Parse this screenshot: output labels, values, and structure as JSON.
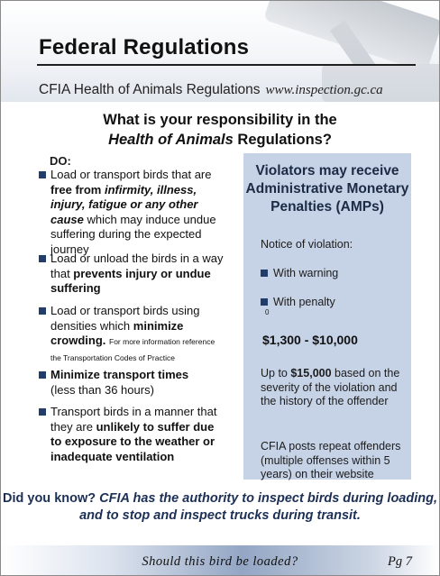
{
  "header": {
    "title": "Federal Regulations",
    "subtitle": "CFIA Health of Animals Regulations",
    "url": "www.inspection.gc.ca"
  },
  "question": {
    "line1": "What is your responsibility in the",
    "line2_italic": "Health of Animals",
    "line2_rest": " Regulations?"
  },
  "do_list": {
    "label": "DO:",
    "items": [
      {
        "a": "Load or transport birds that are ",
        "b": "free from ",
        "c": "infirmity, illness, injury, fatigue or any other cause",
        "d": " which may induce undue suffering during the expected journey"
      },
      {
        "a": "Load or unload the birds in a way that ",
        "b": "prevents injury or undue suffering"
      },
      {
        "a": "Load or transport birds using densities which ",
        "b": "minimize crowding.",
        "c": "For more information reference the Transportation Codes of Practice"
      },
      {
        "a": "Minimize transport times",
        "b": "(less than 36 hours)"
      },
      {
        "a": "Transport birds in a manner that they are ",
        "b": "unlikely to suffer due to exposure to the weather or inadequate ventilation"
      }
    ]
  },
  "penalty_box": {
    "title": "Violators may receive Administrative Monetary Penalties (AMPs)",
    "notice": "Notice of violation:",
    "option1": "With warning",
    "option2": "With penalty",
    "marker": "0",
    "amount": "$1,300 - $10,000",
    "upto_prefix": "Up to ",
    "upto_amount": "$15,000",
    "upto_rest": " based on the severity of the violation and the history of the offender",
    "repeat": "CFIA posts repeat offenders (multiple offenses within 5 years) on their website"
  },
  "did_you_know": {
    "label": "Did you know?",
    "text": " CFIA has the authority to inspect birds during loading, and to stop and inspect trucks during transit."
  },
  "footer": {
    "text": "Should this bird be loaded?",
    "page": "Pg 7"
  },
  "colors": {
    "bullet": "#233d6b",
    "box_bg": "#c6d2e6",
    "dyk_text": "#1c2f55"
  }
}
